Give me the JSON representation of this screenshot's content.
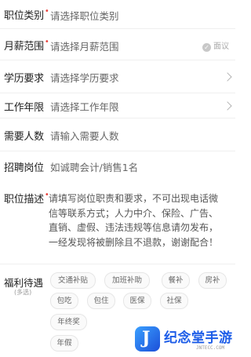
{
  "form": {
    "job_category": {
      "label": "职位类别",
      "placeholder": "请选择职位类别"
    },
    "salary": {
      "label": "月薪范围",
      "placeholder": "请选择月薪范围",
      "negotiable": "面议"
    },
    "education": {
      "label": "学历要求",
      "placeholder": "请选择学历要求"
    },
    "experience": {
      "label": "工作年限",
      "placeholder": "请选择工作年限"
    },
    "headcount": {
      "label": "需要人数",
      "placeholder": "请输入需要人数"
    },
    "recruit_position": {
      "label": "招聘岗位",
      "placeholder": "如诚聘会计/销售1名"
    },
    "description": {
      "label": "职位描述",
      "placeholder": "请填写岗位职责和要求，不可出现电话微信等联系方式；人力中介、保险、广告、直销、虚假、违法违规等信息请勿发布，一经发现将被删除且不退款，谢谢配合！"
    },
    "benefits": {
      "label": "福利待遇",
      "sublabel": "(多选)",
      "tags": [
        "交通补贴",
        "加班补助",
        "餐补",
        "房补",
        "包吃",
        "包住",
        "医保",
        "社保",
        "年终奖",
        "年假"
      ]
    }
  },
  "watermark": {
    "name": "纪念堂手游",
    "url": "JNTECC.COM",
    "icon_letter": "J"
  },
  "colors": {
    "required_mark": "#e8413c",
    "watermark_blue": "#1d5de8"
  }
}
